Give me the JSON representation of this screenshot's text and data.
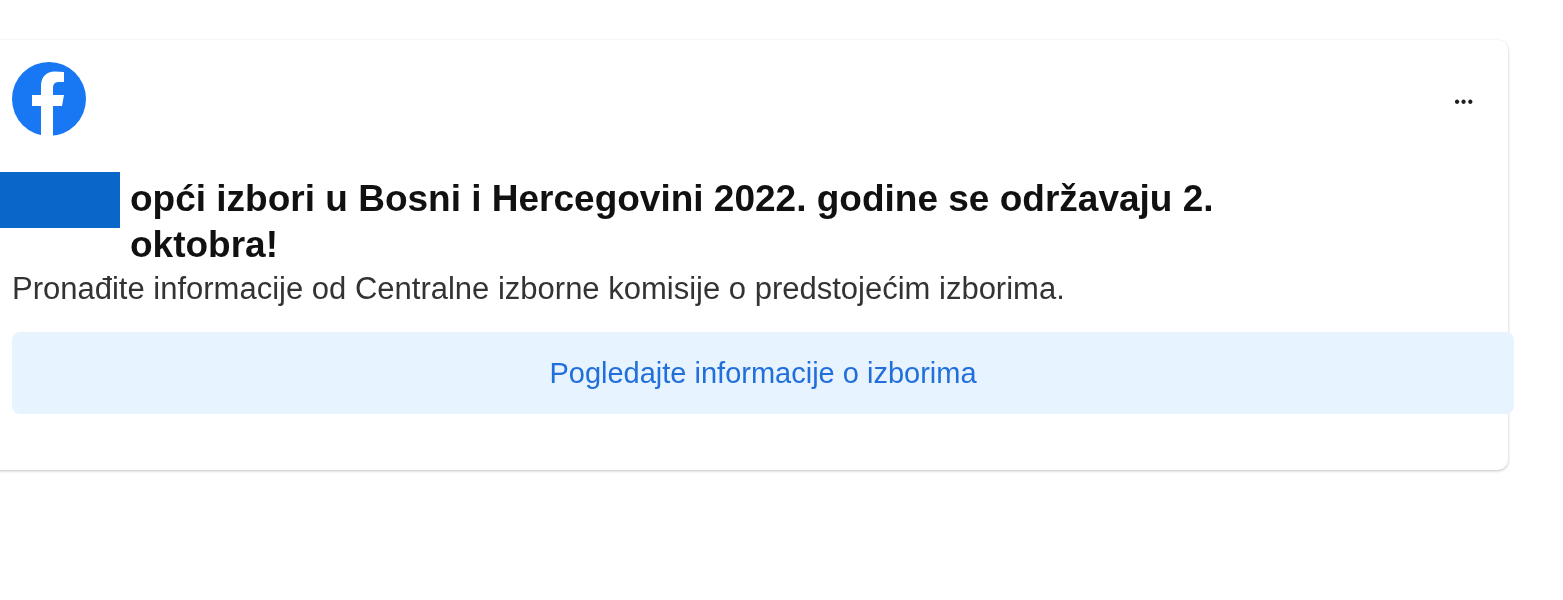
{
  "card": {
    "title": "opći izbori u Bosni i Hercegovini 2022. godine se održavaju 2. oktobra!",
    "description": "Pronađite informacije od Centralne izborne komisije o predstojećim izborima.",
    "more_button": "•••",
    "action_button": "Pogledajte informacije o izborima"
  }
}
